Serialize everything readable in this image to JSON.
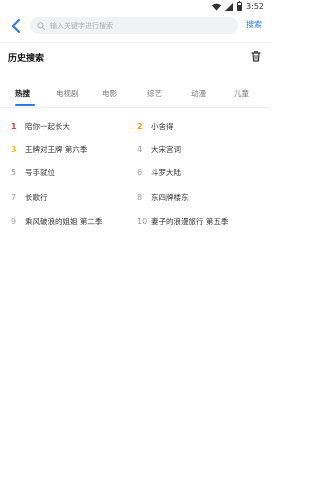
{
  "status_bar": {
    "time": "3:52"
  },
  "search": {
    "placeholder": "输入关键字进行搜索",
    "button_label": "搜索"
  },
  "history": {
    "title": "历史搜索"
  },
  "tabs": [
    {
      "label": "热搜",
      "active": true
    },
    {
      "label": "电视剧",
      "active": false
    },
    {
      "label": "电影",
      "active": false
    },
    {
      "label": "综艺",
      "active": false
    },
    {
      "label": "动漫",
      "active": false
    },
    {
      "label": "儿童",
      "active": false
    }
  ],
  "hot_list": [
    {
      "rank": "1",
      "title": "陪你一起长大"
    },
    {
      "rank": "2",
      "title": "小舍得"
    },
    {
      "rank": "3",
      "title": "王牌对王牌 第六季"
    },
    {
      "rank": "4",
      "title": "大宋宫词"
    },
    {
      "rank": "5",
      "title": "号手就位"
    },
    {
      "rank": "6",
      "title": "斗罗大陆"
    },
    {
      "rank": "7",
      "title": "长歌行"
    },
    {
      "rank": "8",
      "title": "东四牌楼东"
    },
    {
      "rank": "9",
      "title": "乘风破浪的姐姐 第二季"
    },
    {
      "rank": "10",
      "title": "妻子的浪漫旅行 第五季"
    }
  ],
  "colors": {
    "accent": "#2b7be7",
    "rank1": "#e33a3a",
    "rank2": "#f29b13",
    "rank3": "#f2c313"
  }
}
